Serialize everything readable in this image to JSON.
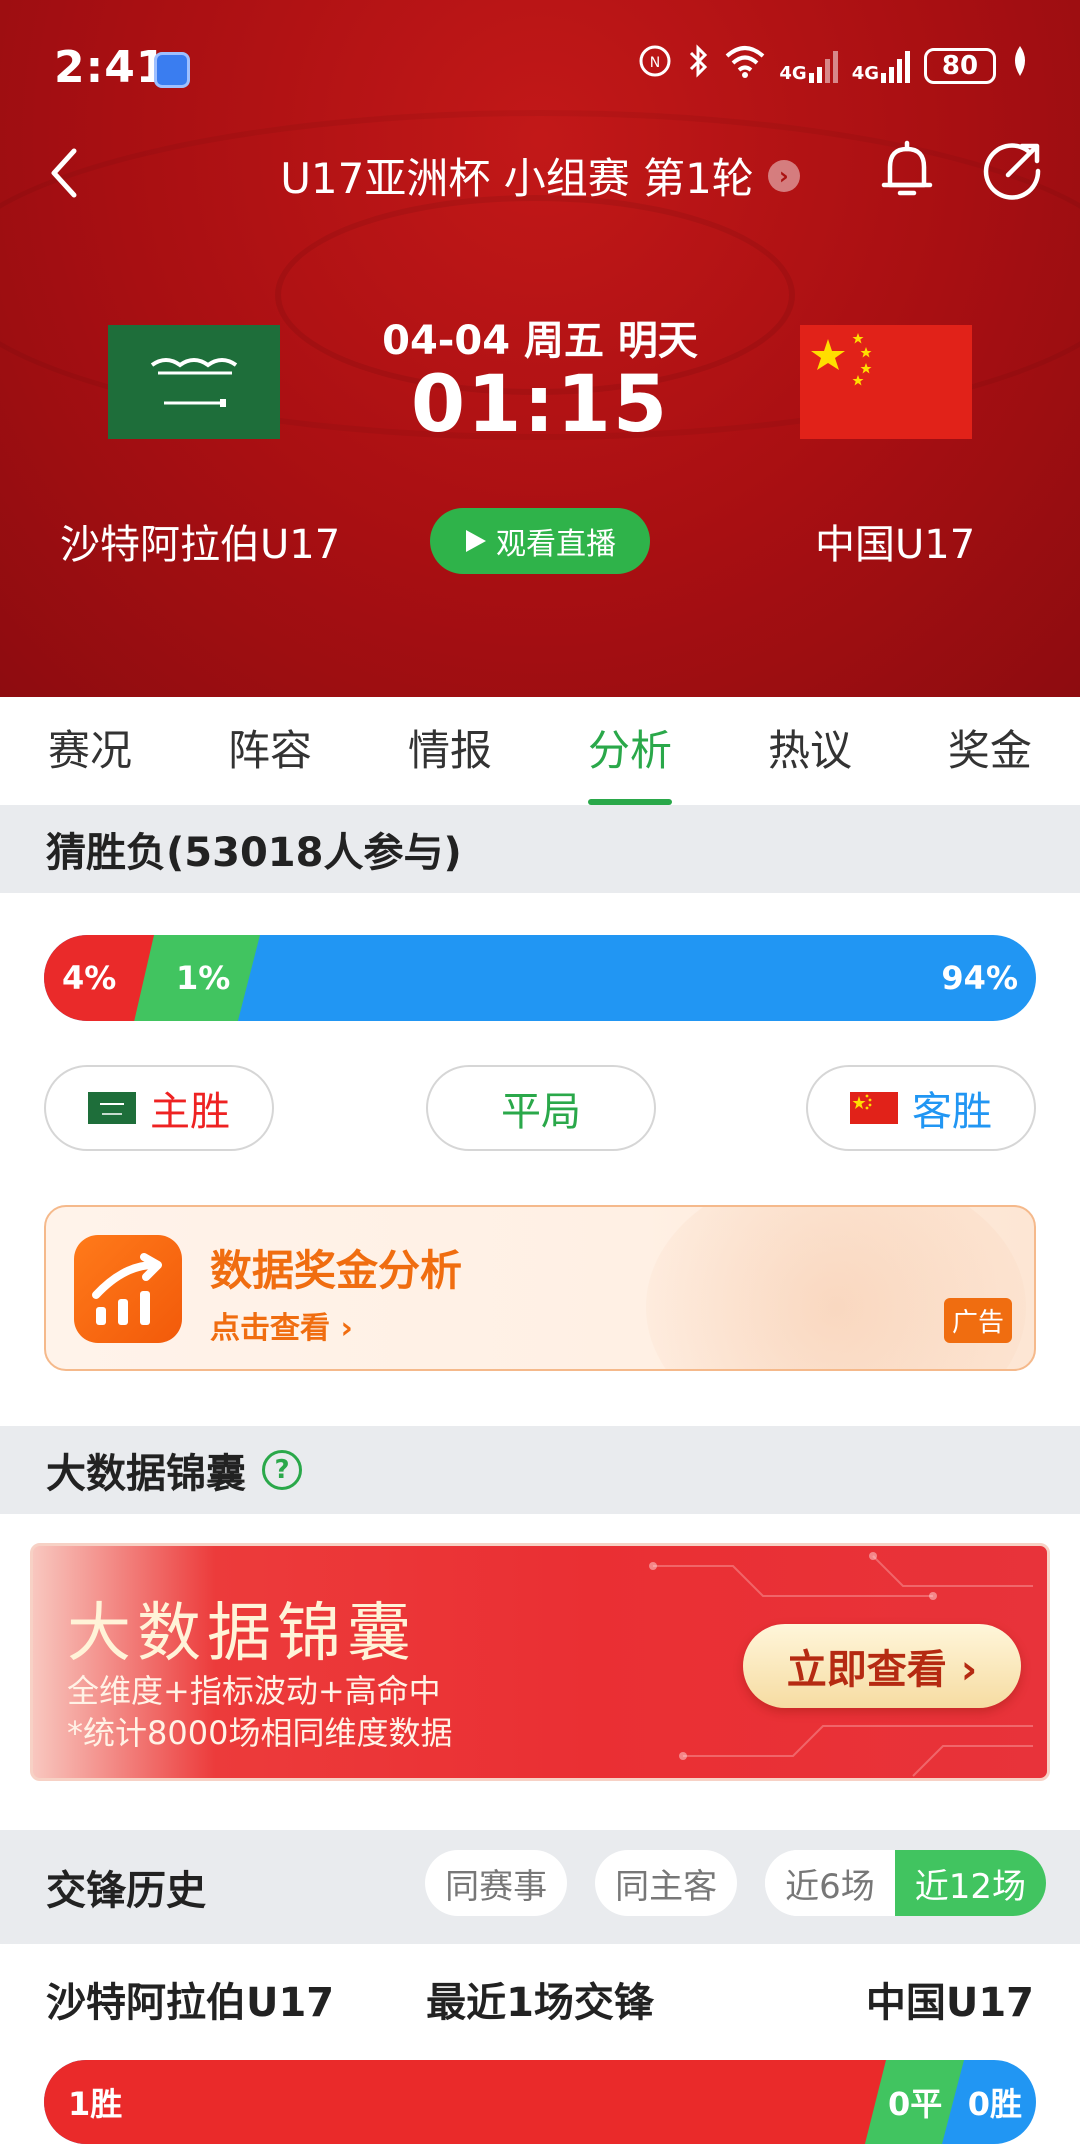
{
  "status_bar": {
    "time": "2:41",
    "network_1": "4G",
    "network_2": "4G",
    "battery": "80"
  },
  "nav": {
    "title": "U17亚洲杯 小组赛 第1轮",
    "icons": [
      "back-arrow-icon",
      "chevron-right-icon",
      "bell-icon",
      "share-icon"
    ]
  },
  "match": {
    "date_line": "04-04 周五 明天",
    "kickoff": "01:15",
    "home_team": "沙特阿拉伯U17",
    "away_team": "中国U17",
    "watch_label": "观看直播"
  },
  "tabs": [
    "赛况",
    "阵容",
    "情报",
    "分析",
    "热议",
    "奖金"
  ],
  "active_tab": "分析",
  "prediction": {
    "header": "猜胜负(53018人参与)",
    "home_pct": "4%",
    "draw_pct": "1%",
    "away_pct": "94%",
    "home_label": "主胜",
    "draw_label": "平局",
    "away_label": "客胜"
  },
  "ad": {
    "title": "数据奖金分析",
    "subtitle": "点击查看 ›",
    "tag": "广告"
  },
  "bigdata": {
    "header": "大数据锦囊",
    "help": "?",
    "banner_title": "大数据锦囊",
    "line1": "全维度+指标波动+高命中",
    "line2": "*统计8000场相同维度数据",
    "button": "立即查看 ›"
  },
  "history": {
    "header": "交锋历史",
    "filter_same_event": "同赛事",
    "filter_same_home": "同主客",
    "filter_last6": "近6场",
    "filter_last12": "近12场",
    "home_team": "沙特阿拉伯U17",
    "summary": "最近1场交锋",
    "away_team": "中国U17",
    "home_wins": "1胜",
    "draws": "0平",
    "away_wins": "0胜"
  },
  "colors": {
    "header_red": "#a80f12",
    "accent_green": "#2aa84a",
    "home_red": "#ea2a2a",
    "away_blue": "#2196f3",
    "ad_orange": "#f06d10"
  }
}
